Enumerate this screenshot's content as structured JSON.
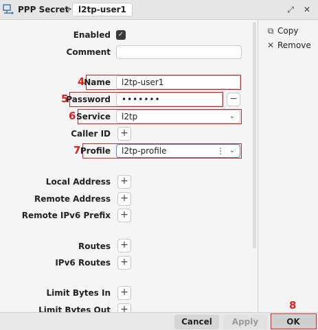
{
  "header": {
    "icon": "ppp-network-icon",
    "title": "PPP Secret",
    "separator": ">",
    "tab": "l2tp-user1",
    "buttons": [
      "expand-icon",
      "close-icon"
    ]
  },
  "actions": {
    "copy": "Copy",
    "remove": "Remove"
  },
  "form": {
    "enabled_label": "Enabled",
    "enabled_checked": true,
    "comment_label": "Comment",
    "comment_value": "",
    "name_label": "Name",
    "name_value": "l2tp-user1",
    "password_label": "Password",
    "password_value": "•••••••",
    "service_label": "Service",
    "service_value": "l2tp",
    "caller_id_label": "Caller ID",
    "profile_label": "Profile",
    "profile_value": "l2tp-profile",
    "local_address_label": "Local Address",
    "remote_address_label": "Remote Address",
    "remote_ipv6_prefix_label": "Remote IPv6 Prefix",
    "routes_label": "Routes",
    "ipv6_routes_label": "IPv6 Routes",
    "limit_bytes_in_label": "Limit Bytes In",
    "limit_bytes_out_label": "Limit Bytes Out"
  },
  "annotations": {
    "name_marker": "4",
    "password_marker": "5",
    "service_marker": "6",
    "profile_marker": "7",
    "ok_marker": "8",
    "color": "#e02020"
  },
  "footer": {
    "cancel": "Cancel",
    "apply": "Apply",
    "ok": "OK"
  }
}
